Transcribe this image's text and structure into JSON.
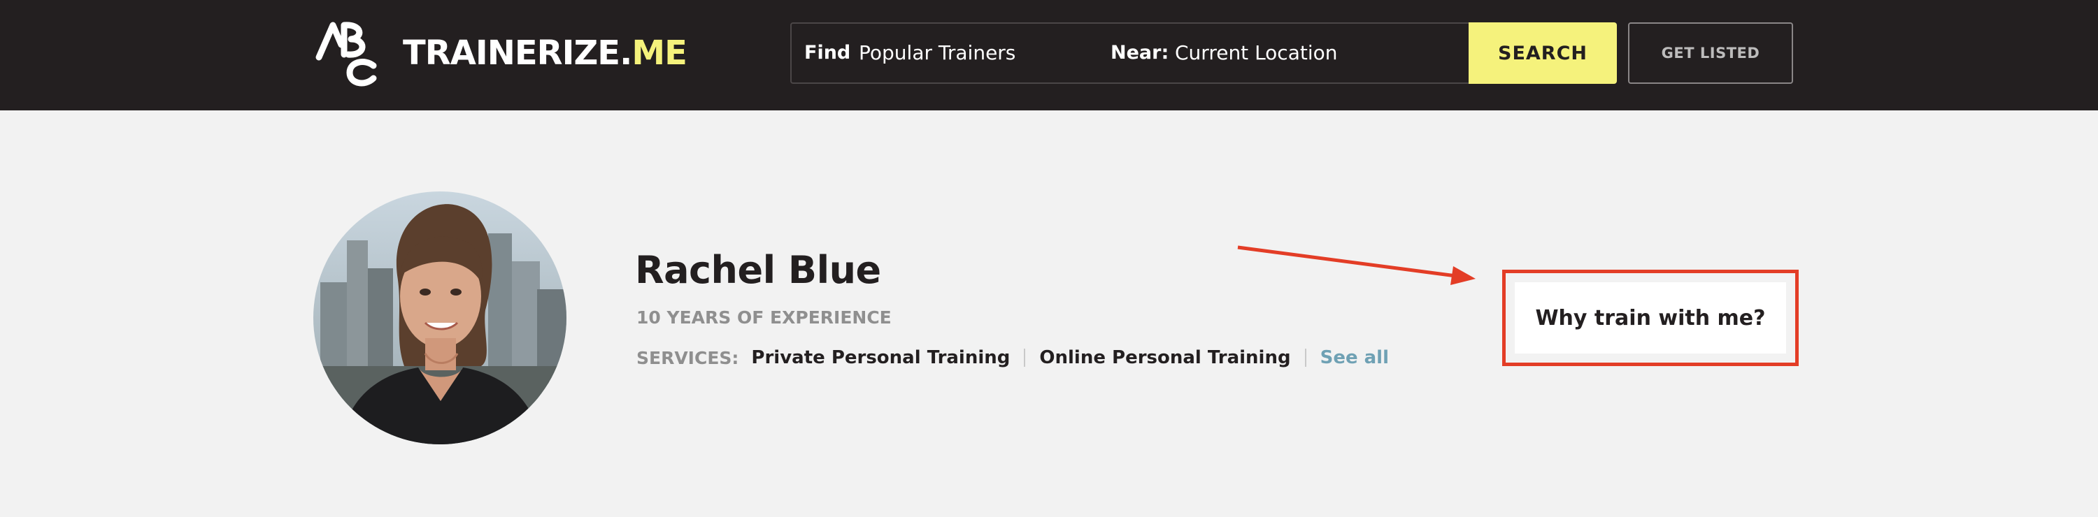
{
  "header": {
    "logo": {
      "text_main": "TRAINERIZE.",
      "text_accent": "ME",
      "icon": "abc-logo-mark"
    },
    "search": {
      "find_label": "Find",
      "find_value": "Popular Trainers",
      "near_label": "Near:",
      "near_value": "Current Location",
      "button_label": "SEARCH"
    },
    "get_listed_label": "GET LISTED"
  },
  "profile": {
    "name": "Rachel Blue",
    "experience": "10 YEARS OF EXPERIENCE",
    "services_label": "SERVICES:",
    "services": [
      "Private Personal Training",
      "Online Personal Training"
    ],
    "see_all_label": "See all",
    "avatar": "trainer-photo"
  },
  "cta": {
    "why_label": "Why train with me?"
  },
  "colors": {
    "header_bg": "#231f20",
    "accent_yellow": "#f5f27c",
    "page_bg": "#f2f2f2",
    "muted_text": "#8f8f8f",
    "link": "#6fa1b4",
    "annotation_red": "#e33d26"
  }
}
